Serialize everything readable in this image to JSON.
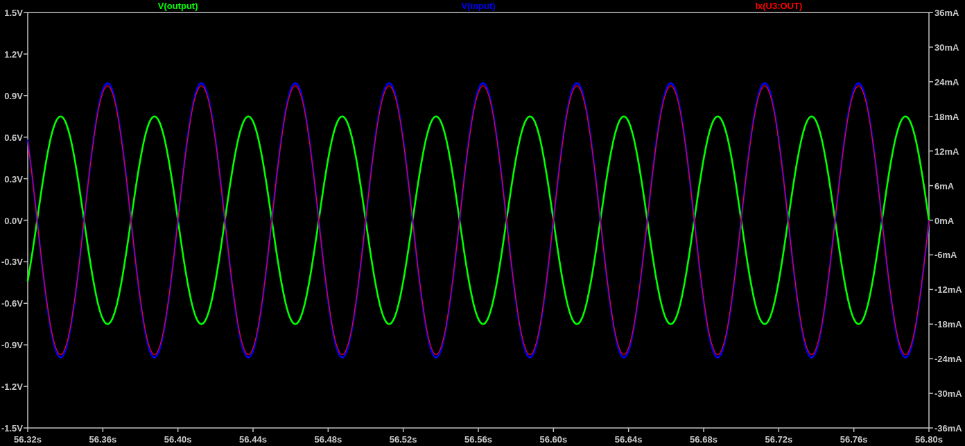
{
  "chart_data": {
    "type": "line",
    "x": [
      56.32,
      56.3225,
      56.325,
      56.3275,
      56.33,
      56.3325,
      56.335,
      56.3375,
      56.34,
      56.3425,
      56.345,
      56.3475,
      56.35,
      56.3525,
      56.355,
      56.3575,
      56.36,
      56.3625,
      56.365,
      56.3675,
      56.37,
      56.3725,
      56.375,
      56.3775,
      56.38,
      56.3825,
      56.385,
      56.3875,
      56.39,
      56.3925,
      56.395,
      56.3975,
      56.4,
      56.4025,
      56.405,
      56.4075,
      56.41,
      56.4125,
      56.415,
      56.4175,
      56.42,
      56.4225,
      56.425,
      56.4275,
      56.43,
      56.4325,
      56.435,
      56.4375,
      56.44,
      56.4425,
      56.445,
      56.4475,
      56.45,
      56.4525,
      56.455,
      56.4575,
      56.46,
      56.4625,
      56.465,
      56.4675,
      56.47,
      56.4725,
      56.475,
      56.4775,
      56.48,
      56.4825,
      56.485,
      56.4875,
      56.49,
      56.4925,
      56.495,
      56.4975,
      56.5,
      56.5025,
      56.505,
      56.5075,
      56.51,
      56.5125,
      56.515,
      56.5175,
      56.52,
      56.5225,
      56.525,
      56.5275,
      56.53,
      56.5325,
      56.535,
      56.5375,
      56.54,
      56.5425,
      56.545,
      56.5475,
      56.55,
      56.5525,
      56.555,
      56.5575,
      56.56,
      56.5625,
      56.565,
      56.5675,
      56.57,
      56.5725,
      56.575,
      56.5775,
      56.58,
      56.5825,
      56.585,
      56.5875,
      56.59,
      56.5925,
      56.595,
      56.5975,
      56.6,
      56.6025,
      56.605,
      56.6075,
      56.61,
      56.6125,
      56.615,
      56.6175,
      56.62,
      56.6225,
      56.625,
      56.6275,
      56.63,
      56.6325,
      56.635,
      56.6375,
      56.64,
      56.6425,
      56.645,
      56.6475,
      56.65,
      56.6525,
      56.655,
      56.6575,
      56.66,
      56.6625,
      56.665,
      56.6675,
      56.67,
      56.6725,
      56.675,
      56.6775,
      56.68,
      56.6825,
      56.685,
      56.6875,
      56.69,
      56.6925,
      56.695,
      56.6975,
      56.7,
      56.7025,
      56.705,
      56.7075,
      56.71,
      56.7125,
      56.715,
      56.7175,
      56.72,
      56.7225,
      56.725,
      56.7275,
      56.73,
      56.7325,
      56.735,
      56.7375,
      56.74,
      56.7425,
      56.745,
      56.7475,
      56.75,
      56.7525,
      56.755,
      56.7575,
      56.76,
      56.7625,
      56.765,
      56.7675,
      56.77,
      56.7725,
      56.775,
      56.7775,
      56.78,
      56.7825,
      56.785,
      56.7875,
      56.79,
      56.7925,
      56.795,
      56.7975,
      56.8
    ],
    "series": [
      {
        "name": "V(output)",
        "color": "#00ff00",
        "values": [
          -0.441,
          -0.232,
          0,
          0.232,
          0.441,
          0.607,
          0.713,
          0.75,
          0.713,
          0.607,
          0.441,
          0.232,
          0,
          -0.232,
          -0.441,
          -0.607,
          -0.713,
          -0.75,
          -0.713,
          -0.607,
          -0.441,
          -0.232,
          0,
          0.232,
          0.441,
          0.607,
          0.713,
          0.75,
          0.713,
          0.607,
          0.441,
          0.232,
          0,
          -0.232,
          -0.441,
          -0.607,
          -0.713,
          -0.75,
          -0.713,
          -0.607,
          -0.441,
          -0.232,
          0,
          0.232,
          0.441,
          0.607,
          0.713,
          0.75,
          0.713,
          0.607,
          0.441,
          0.232,
          0,
          -0.232,
          -0.441,
          -0.607,
          -0.713,
          -0.75,
          -0.713,
          -0.607,
          -0.441,
          -0.232,
          0,
          0.232,
          0.441,
          0.607,
          0.713,
          0.75,
          0.713,
          0.607,
          0.441,
          0.232,
          0,
          -0.232,
          -0.441,
          -0.607,
          -0.713,
          -0.75,
          -0.713,
          -0.607,
          -0.441,
          -0.232,
          0,
          0.232,
          0.441,
          0.607,
          0.713,
          0.75,
          0.713,
          0.607,
          0.441,
          0.232,
          0,
          -0.232,
          -0.441,
          -0.607,
          -0.713,
          -0.75,
          -0.713,
          -0.607,
          -0.441,
          -0.232,
          0,
          0.232,
          0.441,
          0.607,
          0.713,
          0.75,
          0.713,
          0.607,
          0.441,
          0.232,
          0,
          -0.232,
          -0.441,
          -0.607,
          -0.713,
          -0.75,
          -0.713,
          -0.607,
          -0.441,
          -0.232,
          0,
          0.232,
          0.441,
          0.607,
          0.713,
          0.75,
          0.713,
          0.607,
          0.441,
          0.232,
          0,
          -0.232,
          -0.441,
          -0.607,
          -0.713,
          -0.75,
          -0.713,
          -0.607,
          -0.441,
          -0.232,
          0,
          0.232,
          0.441,
          0.607,
          0.713,
          0.75,
          0.713,
          0.607,
          0.441,
          0.232,
          0,
          -0.232,
          -0.441,
          -0.607,
          -0.713,
          -0.75,
          -0.713,
          -0.607,
          -0.441,
          -0.232,
          0,
          0.232,
          0.441,
          0.607,
          0.713,
          0.75,
          0.713,
          0.607,
          0.441,
          0.232,
          0,
          -0.232,
          -0.441,
          -0.607,
          -0.713,
          -0.75,
          -0.713,
          -0.607,
          -0.441,
          -0.232,
          0,
          0.232,
          0.441,
          0.607,
          0.713,
          0.75,
          0.713,
          0.607,
          0.441,
          0.232,
          0
        ]
      },
      {
        "name": "V(input)",
        "color": "#0000ff",
        "values": [
          0.582,
          0.306,
          0,
          -0.306,
          -0.582,
          -0.801,
          -0.942,
          -0.99,
          -0.942,
          -0.801,
          -0.582,
          -0.306,
          0,
          0.306,
          0.582,
          0.801,
          0.942,
          0.99,
          0.942,
          0.801,
          0.582,
          0.306,
          0,
          -0.306,
          -0.582,
          -0.801,
          -0.942,
          -0.99,
          -0.942,
          -0.801,
          -0.582,
          -0.306,
          0,
          0.306,
          0.582,
          0.801,
          0.942,
          0.99,
          0.942,
          0.801,
          0.582,
          0.306,
          0,
          -0.306,
          -0.582,
          -0.801,
          -0.942,
          -0.99,
          -0.942,
          -0.801,
          -0.582,
          -0.306,
          0,
          0.306,
          0.582,
          0.801,
          0.942,
          0.99,
          0.942,
          0.801,
          0.582,
          0.306,
          0,
          -0.306,
          -0.582,
          -0.801,
          -0.942,
          -0.99,
          -0.942,
          -0.801,
          -0.582,
          -0.306,
          0,
          0.306,
          0.582,
          0.801,
          0.942,
          0.99,
          0.942,
          0.801,
          0.582,
          0.306,
          0,
          -0.306,
          -0.582,
          -0.801,
          -0.942,
          -0.99,
          -0.942,
          -0.801,
          -0.582,
          -0.306,
          0,
          0.306,
          0.582,
          0.801,
          0.942,
          0.99,
          0.942,
          0.801,
          0.582,
          0.306,
          0,
          -0.306,
          -0.582,
          -0.801,
          -0.942,
          -0.99,
          -0.942,
          -0.801,
          -0.582,
          -0.306,
          0,
          0.306,
          0.582,
          0.801,
          0.942,
          0.99,
          0.942,
          0.801,
          0.582,
          0.306,
          0,
          -0.306,
          -0.582,
          -0.801,
          -0.942,
          -0.99,
          -0.942,
          -0.801,
          -0.582,
          -0.306,
          0,
          0.306,
          0.582,
          0.801,
          0.942,
          0.99,
          0.942,
          0.801,
          0.582,
          0.306,
          0,
          -0.306,
          -0.582,
          -0.801,
          -0.942,
          -0.99,
          -0.942,
          -0.801,
          -0.582,
          -0.306,
          0,
          0.306,
          0.582,
          0.801,
          0.942,
          0.99,
          0.942,
          0.801,
          0.582,
          0.306,
          0,
          -0.306,
          -0.582,
          -0.801,
          -0.942,
          -0.99,
          -0.942,
          -0.801,
          -0.582,
          -0.306,
          0,
          0.306,
          0.582,
          0.801,
          0.942,
          0.99,
          0.942,
          0.801,
          0.582,
          0.306,
          0,
          -0.306,
          -0.582,
          -0.801,
          -0.942,
          -0.99,
          -0.942,
          -0.801,
          -0.582,
          -0.306,
          0
        ]
      },
      {
        "name": "Ix(U3:OUT)",
        "color": "#ff0000",
        "axis": "y2",
        "values": [
          13.7,
          7.3,
          0,
          -7.3,
          -13.7,
          -18.9,
          -22.1,
          -23.3,
          -22.1,
          -18.9,
          -13.7,
          -7.3,
          0,
          7.3,
          13.7,
          18.9,
          22.1,
          23.3,
          22.1,
          18.9,
          13.7,
          7.3,
          0,
          -7.3,
          -13.7,
          -18.9,
          -22.1,
          -23.3,
          -22.1,
          -18.9,
          -13.7,
          -7.3,
          0,
          7.3,
          13.7,
          18.9,
          22.1,
          23.3,
          22.1,
          18.9,
          13.7,
          7.3,
          0,
          -7.3,
          -13.7,
          -18.9,
          -22.1,
          -23.3,
          -22.1,
          -18.9,
          -13.7,
          -7.3,
          0,
          7.3,
          13.7,
          18.9,
          22.1,
          23.3,
          22.1,
          18.9,
          13.7,
          7.3,
          0,
          -7.3,
          -13.7,
          -18.9,
          -22.1,
          -23.3,
          -22.1,
          -18.9,
          -13.7,
          -7.3,
          0,
          7.3,
          13.7,
          18.9,
          22.1,
          23.3,
          22.1,
          18.9,
          13.7,
          7.3,
          0,
          -7.3,
          -13.7,
          -18.9,
          -22.1,
          -23.3,
          -22.1,
          -18.9,
          -13.7,
          -7.3,
          0,
          7.3,
          13.7,
          18.9,
          22.1,
          23.3,
          22.1,
          18.9,
          13.7,
          7.3,
          0,
          -7.3,
          -13.7,
          -18.9,
          -22.1,
          -23.3,
          -22.1,
          -18.9,
          -13.7,
          -7.3,
          0,
          7.3,
          13.7,
          18.9,
          22.1,
          23.3,
          22.1,
          18.9,
          13.7,
          7.3,
          0,
          -7.3,
          -13.7,
          -18.9,
          -22.1,
          -23.3,
          -22.1,
          -18.9,
          -13.7,
          -7.3,
          0,
          7.3,
          13.7,
          18.9,
          22.1,
          23.3,
          22.1,
          18.9,
          13.7,
          7.3,
          0,
          -7.3,
          -13.7,
          -18.9,
          -22.1,
          -23.3,
          -22.1,
          -18.9,
          -13.7,
          -7.3,
          0,
          7.3,
          13.7,
          18.9,
          22.1,
          23.3,
          22.1,
          18.9,
          13.7,
          7.3,
          0,
          -7.3,
          -13.7,
          -18.9,
          -22.1,
          -23.3,
          -22.1,
          -18.9,
          -13.7,
          -7.3,
          0,
          7.3,
          13.7,
          18.9,
          22.1,
          23.3,
          22.1,
          18.9,
          13.7,
          7.3,
          0,
          -7.3,
          -13.7,
          -18.9,
          -22.1,
          -23.3,
          -22.1,
          -18.9,
          -13.7,
          -7.3,
          0
        ]
      }
    ],
    "xlim": [
      56.32,
      56.8
    ],
    "ylim": [
      -1.5,
      1.5
    ],
    "y2lim": [
      -36,
      36
    ],
    "xticks": [
      {
        "value": 56.32,
        "label": "56.32s"
      },
      {
        "value": 56.36,
        "label": "56.36s"
      },
      {
        "value": 56.4,
        "label": "56.40s"
      },
      {
        "value": 56.44,
        "label": "56.44s"
      },
      {
        "value": 56.48,
        "label": "56.48s"
      },
      {
        "value": 56.52,
        "label": "56.52s"
      },
      {
        "value": 56.56,
        "label": "56.56s"
      },
      {
        "value": 56.6,
        "label": "56.60s"
      },
      {
        "value": 56.64,
        "label": "56.64s"
      },
      {
        "value": 56.68,
        "label": "56.68s"
      },
      {
        "value": 56.72,
        "label": "56.72s"
      },
      {
        "value": 56.76,
        "label": "56.76s"
      },
      {
        "value": 56.8,
        "label": "56.80s"
      }
    ],
    "yticks": [
      {
        "value": 1.5,
        "label": "1.5V"
      },
      {
        "value": 1.2,
        "label": "1.2V"
      },
      {
        "value": 0.9,
        "label": "0.9V"
      },
      {
        "value": 0.6,
        "label": "0.6V"
      },
      {
        "value": 0.3,
        "label": "0.3V"
      },
      {
        "value": 0,
        "label": "0.0V"
      },
      {
        "value": -0.3,
        "label": "-0.3V"
      },
      {
        "value": -0.6,
        "label": "-0.6V"
      },
      {
        "value": -0.9,
        "label": "-0.9V"
      },
      {
        "value": -1.2,
        "label": "-1.2V"
      },
      {
        "value": -1.5,
        "label": "-1.5V"
      }
    ],
    "y2ticks": [
      {
        "value": 36,
        "label": "36mA"
      },
      {
        "value": 30,
        "label": "30mA"
      },
      {
        "value": 24,
        "label": "24mA"
      },
      {
        "value": 18,
        "label": "18mA"
      },
      {
        "value": 12,
        "label": "12mA"
      },
      {
        "value": 6,
        "label": "6mA"
      },
      {
        "value": 0,
        "label": "0mA"
      },
      {
        "value": -6,
        "label": "-6mA"
      },
      {
        "value": -12,
        "label": "-12mA"
      },
      {
        "value": -18,
        "label": "-18mA"
      },
      {
        "value": -24,
        "label": "-24mA"
      },
      {
        "value": -30,
        "label": "-30mA"
      },
      {
        "value": -36,
        "label": "-36mA"
      }
    ]
  }
}
